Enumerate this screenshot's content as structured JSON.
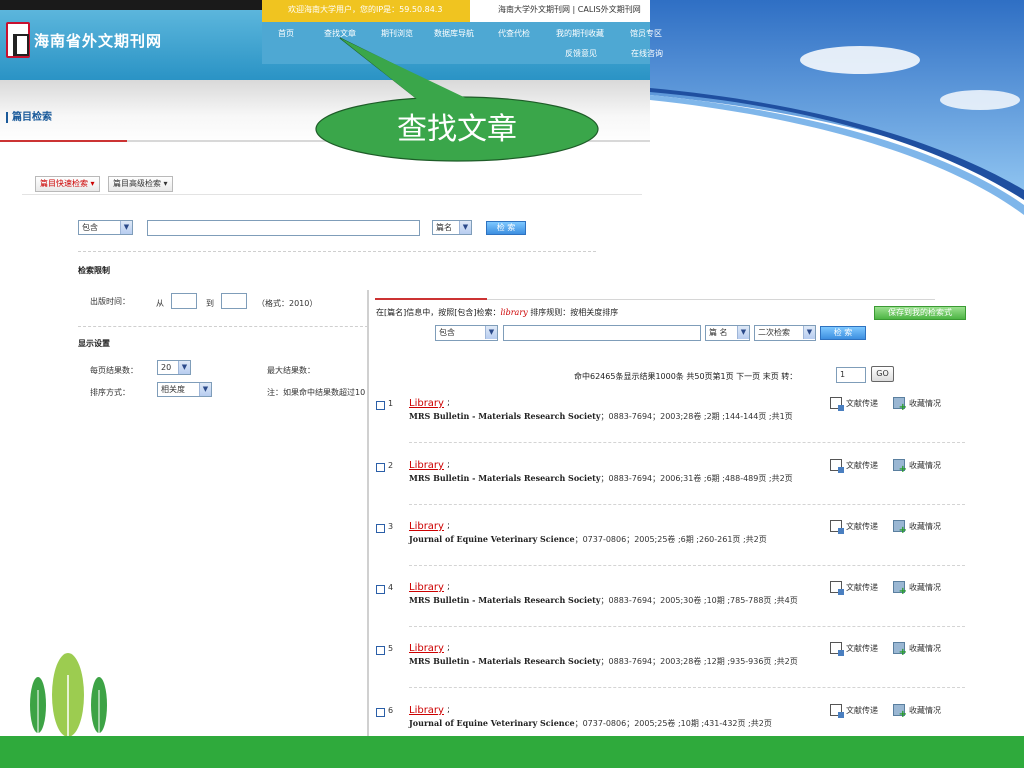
{
  "header": {
    "site_name": "海南省外文期刊网",
    "welcome_text": "欢迎海南大学用户，您的IP是：59.50.84.3",
    "top_links": "海南大学外文期刊网 | CALIS外文期刊网",
    "nav": [
      "首页",
      "查找文章",
      "期刊浏览",
      "数据库导航",
      "代查代检",
      "我的期刊收藏",
      "馆员专区"
    ],
    "nav_row2": [
      "反馈意见",
      "在线咨询"
    ],
    "section_title": "篇目检索"
  },
  "callout": {
    "text": "查找文章"
  },
  "search": {
    "tabs": [
      "篇目快速检索",
      "篇目高级检索"
    ],
    "match_select": "包含",
    "field_select": "篇名",
    "search_button": "检 索",
    "limit_title": "检索限制",
    "pub_time_label": "出版时间：",
    "from_label": "从",
    "to_label": "到",
    "format_hint": "（格式：2010）",
    "display_title": "显示设置",
    "per_page_label": "每页结果数：",
    "per_page_value": "20",
    "max_results_label": "最大结果数：",
    "sort_label": "排序方式：",
    "sort_value": "相关度",
    "note_text": "注：如果命中结果数超过10"
  },
  "results": {
    "info_prefix": "在[篇名]信息中，按照[包含]检索：",
    "info_keyword": "library",
    "info_suffix": " 排序规则：按相关度排序",
    "save_button": "保存到我的检索式",
    "match_select": "包含",
    "field_select": "篇 名",
    "scope_select": "二次检索",
    "search_button": "检 索",
    "paging_text": "命中62465条显示结果1000条  共50页第1页  下一页  末页  转：",
    "page_input": "1",
    "go_button": "GO",
    "action_delivery": "文献传递",
    "action_holdings": "收藏情况",
    "records": [
      {
        "num": "1",
        "title": "Library",
        "journal": "MRS Bulletin - Materials Research Society",
        "details": "；0883-7694；2003;28卷 ;2期 ;144-144页 ;共1页"
      },
      {
        "num": "2",
        "title": "Library",
        "journal": "MRS Bulletin - Materials Research Society",
        "details": "；0883-7694；2006;31卷 ;6期 ;488-489页 ;共2页"
      },
      {
        "num": "3",
        "title": "Library",
        "journal": "Journal of Equine Veterinary Science",
        "details": "；0737-0806；2005;25卷 ;6期 ;260-261页 ;共2页"
      },
      {
        "num": "4",
        "title": "Library",
        "journal": "MRS Bulletin - Materials Research Society",
        "details": "；0883-7694；2005;30卷 ;10期 ;785-788页 ;共4页"
      },
      {
        "num": "5",
        "title": "Library",
        "journal": "MRS Bulletin - Materials Research Society",
        "details": "；0883-7694；2003;28卷 ;12期 ;935-936页 ;共2页"
      },
      {
        "num": "6",
        "title": "Library",
        "journal": "Journal of Equine Veterinary Science",
        "details": "；0737-0806；2005;25卷 ;10期 ;431-432页 ;共2页"
      }
    ]
  },
  "colors": {
    "slide_green": "#2faa3c",
    "swoosh_blue": "#1f5fb0",
    "callout_green": "#3aa64a",
    "link_red": "#cc0000",
    "nav_blue": "#4ea8d3"
  }
}
